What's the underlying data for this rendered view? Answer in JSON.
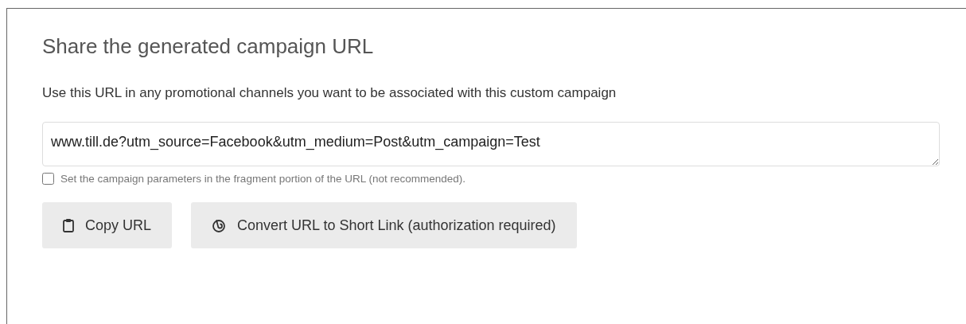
{
  "panel": {
    "title": "Share the generated campaign URL",
    "description": "Use this URL in any promotional channels you want to be associated with this custom campaign",
    "url_field": {
      "value": "www.till.de?utm_source=Facebook&utm_medium=Post&utm_campaign=Test"
    },
    "fragment_option": {
      "label": "Set the campaign parameters in the fragment portion of the URL (not recommended).",
      "checked": false
    },
    "buttons": [
      {
        "kind": "copy",
        "label": "Copy URL"
      },
      {
        "kind": "shorten",
        "label": "Convert URL to Short Link (authorization required)"
      }
    ]
  }
}
